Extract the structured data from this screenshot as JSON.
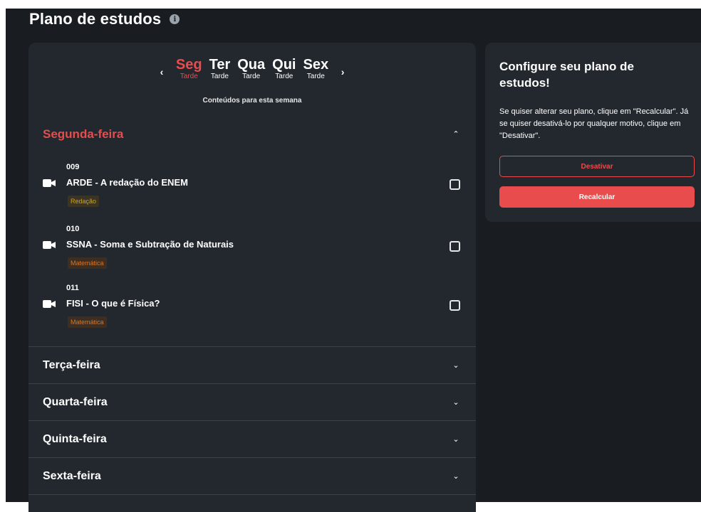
{
  "page": {
    "title": "Plano de estudos"
  },
  "week": {
    "prev_label": "‹",
    "next_label": "›",
    "subtitle": "Conteúdos para esta semana",
    "days": [
      {
        "name": "Seg",
        "period": "Tarde",
        "active": true
      },
      {
        "name": "Ter",
        "period": "Tarde",
        "active": false
      },
      {
        "name": "Qua",
        "period": "Tarde",
        "active": false
      },
      {
        "name": "Qui",
        "period": "Tarde",
        "active": false
      },
      {
        "name": "Sex",
        "period": "Tarde",
        "active": false
      }
    ]
  },
  "sections": [
    {
      "title": "Segunda-feira",
      "expanded": true,
      "items": [
        {
          "number": "009",
          "title": "ARDE - A redação do ENEM",
          "tag": "Redação",
          "tag_color": "#d4a31e"
        },
        {
          "number": "010",
          "title": "SSNA - Soma e Subtração de Naturais",
          "tag": "Matemática",
          "tag_color": "#d8772a"
        },
        {
          "number": "011",
          "title": "FISI - O que é Física?",
          "tag": "Matemática",
          "tag_color": "#d8772a"
        }
      ]
    },
    {
      "title": "Terça-feira",
      "expanded": false
    },
    {
      "title": "Quarta-feira",
      "expanded": false
    },
    {
      "title": "Quinta-feira",
      "expanded": false
    },
    {
      "title": "Sexta-feira",
      "expanded": false
    }
  ],
  "side": {
    "title": "Configure seu plano de estudos!",
    "description": "Se quiser alterar seu plano, clique em \"Recalcular\". Já se quiser desativá-lo por qualquer motivo, clique em \"Desativar\".",
    "deactivate_label": "Desativar",
    "recalc_label": "Recalcular"
  },
  "colors": {
    "accent": "#e84c4c",
    "panel": "#22282e",
    "background": "#191d21"
  },
  "icons": {
    "expanded": "chevron-up-icon",
    "collapsed": "chevron-down-icon",
    "item": "video-camera-icon",
    "info": "info-icon"
  }
}
